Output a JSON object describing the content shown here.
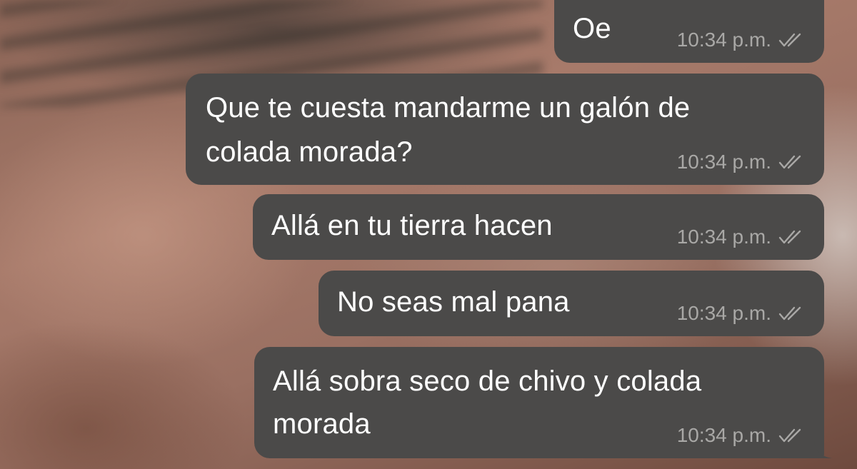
{
  "messages": [
    {
      "text_lines": [
        "Oe"
      ],
      "time": "10:34 p.m.",
      "status_icon": "double-check-icon"
    },
    {
      "text_lines": [
        "Que te cuesta mandarme un galón de",
        "colada morada?"
      ],
      "time": "10:34 p.m.",
      "status_icon": "double-check-icon"
    },
    {
      "text_lines": [
        "Allá en tu tierra hacen"
      ],
      "time": "10:34 p.m.",
      "status_icon": "double-check-icon"
    },
    {
      "text_lines": [
        "No seas mal pana"
      ],
      "time": "10:34 p.m.",
      "status_icon": "double-check-icon"
    },
    {
      "text_lines": [
        "Allá sobra seco de chivo y colada",
        "morada"
      ],
      "time": "10:34 p.m.",
      "status_icon": "double-check-icon"
    }
  ],
  "colors": {
    "bubble": "#4b4a49",
    "text": "#ffffff",
    "meta": "#a9a8a6"
  }
}
